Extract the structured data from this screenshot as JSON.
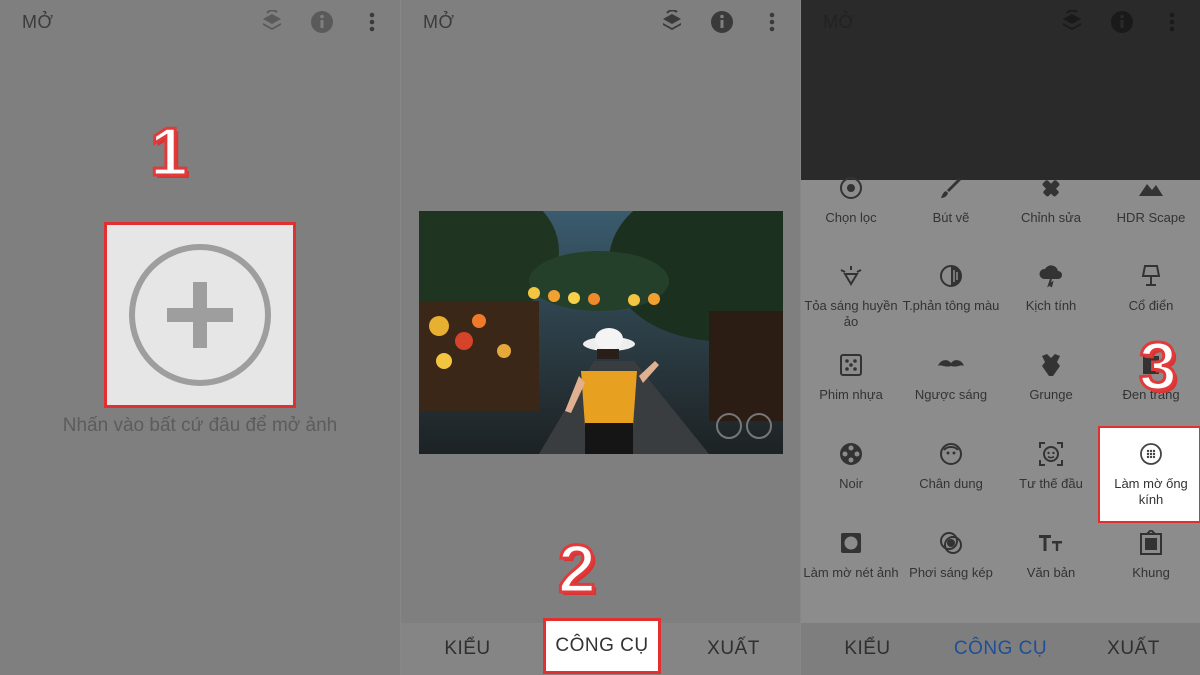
{
  "panel1": {
    "title": "MỞ",
    "step": "1",
    "hint": "Nhấn vào bất cứ đâu để mở ảnh",
    "icons": [
      "layers-refresh-icon",
      "info-icon",
      "more-vert-icon"
    ]
  },
  "panel2": {
    "title": "MỞ",
    "step": "2",
    "tabs": {
      "styles": "KIỂU",
      "tools": "CÔNG CỤ",
      "export": "XUẤT"
    },
    "icons": [
      "layers-refresh-icon",
      "info-icon",
      "more-vert-icon"
    ]
  },
  "panel3": {
    "title": "MỞ",
    "step": "3",
    "tools": [
      {
        "label": "Chọn lọc",
        "icon": "target-icon"
      },
      {
        "label": "Bút vẽ",
        "icon": "brush-icon"
      },
      {
        "label": "Chỉnh sửa",
        "icon": "healing-icon"
      },
      {
        "label": "HDR Scape",
        "icon": "mountain-icon"
      },
      {
        "label": "Tỏa sáng huyền ảo",
        "icon": "diamond-glow-icon"
      },
      {
        "label": "T.phản tông màu",
        "icon": "tonal-contrast-icon"
      },
      {
        "label": "Kịch tính",
        "icon": "cloud-storm-icon"
      },
      {
        "label": "Cổ điển",
        "icon": "lamp-icon"
      },
      {
        "label": "Phim nhựa",
        "icon": "dice-icon"
      },
      {
        "label": "Ngược sáng",
        "icon": "mustache-icon"
      },
      {
        "label": "Grunge",
        "icon": "guitar-icon"
      },
      {
        "label": "Đen trắng",
        "icon": "bw-film-icon"
      },
      {
        "label": "Noir",
        "icon": "film-reel-icon"
      },
      {
        "label": "Chân dung",
        "icon": "face-icon"
      },
      {
        "label": "Tư thế đầu",
        "icon": "face-frame-icon"
      },
      {
        "label": "Làm mờ ống kính",
        "icon": "lens-blur-icon"
      },
      {
        "label": "Làm mờ nét ảnh",
        "icon": "vignette-icon"
      },
      {
        "label": "Phơi sáng kép",
        "icon": "double-exposure-icon"
      },
      {
        "label": "Văn bản",
        "icon": "text-icon"
      },
      {
        "label": "Khung",
        "icon": "frame-icon"
      }
    ],
    "tabs": {
      "styles": "KIỂU",
      "tools": "CÔNG CỤ",
      "export": "XUẤT"
    },
    "icons": [
      "layers-refresh-icon",
      "info-icon",
      "more-vert-icon"
    ]
  },
  "colors": {
    "highlight": "#e23030",
    "active_tab": "#1f4e98"
  }
}
